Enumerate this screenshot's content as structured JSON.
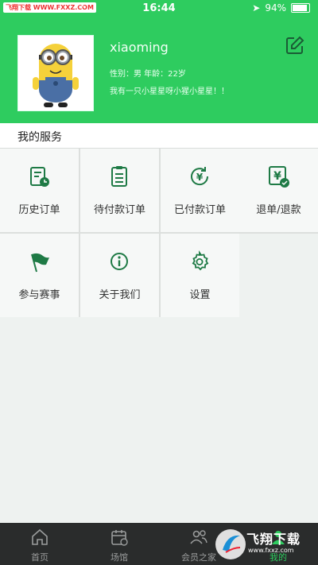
{
  "status_bar": {
    "carrier": "飞翔下载 WWW.FXXZ.COM",
    "time": "16:44",
    "battery": "94%"
  },
  "profile": {
    "username": "xiaoming",
    "info": "性别：男  年龄：22岁",
    "bio": "我有一只小星星呀小猩小星星！！"
  },
  "services": {
    "title": "我的服务",
    "items": [
      {
        "label": "历史订单",
        "icon": "history-order-icon"
      },
      {
        "label": "待付款订单",
        "icon": "pending-payment-icon"
      },
      {
        "label": "已付款订单",
        "icon": "paid-order-icon"
      },
      {
        "label": "退单/退款",
        "icon": "refund-icon"
      },
      {
        "label": "参与赛事",
        "icon": "flag-icon"
      },
      {
        "label": "关于我们",
        "icon": "info-icon"
      },
      {
        "label": "设置",
        "icon": "gear-icon"
      }
    ]
  },
  "tabbar": {
    "items": [
      {
        "label": "首页",
        "icon": "home-icon"
      },
      {
        "label": "场馆",
        "icon": "calendar-icon"
      },
      {
        "label": "会员之家",
        "icon": "members-icon"
      },
      {
        "label": "我的",
        "icon": "profile-icon"
      }
    ],
    "active_index": 3
  },
  "watermark": {
    "text": "飞翔下载",
    "url": "www.fxxz.com"
  },
  "colors": {
    "brand_green": "#2ecc5f",
    "icon_green": "#1e7a45",
    "tabbar_bg": "#2a2c2c"
  }
}
